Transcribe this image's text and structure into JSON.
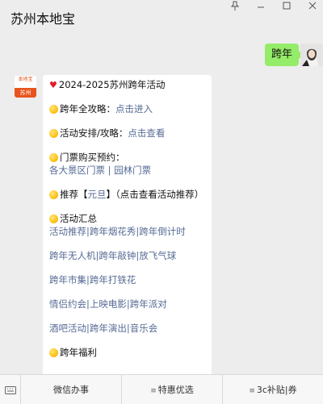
{
  "header": {
    "title": "苏州本地宝",
    "icons": [
      "pin-icon",
      "minimize-icon",
      "maximize-icon",
      "close-icon"
    ]
  },
  "outgoing": {
    "text": "跨年"
  },
  "account_avatar": {
    "top_text": "本地宝",
    "bottom_text": "苏州"
  },
  "message": {
    "heading_prefix": "♥",
    "heading": "2024-2025苏州跨年活动",
    "guide_label": "跨年全攻略：",
    "guide_link": "点击进入",
    "schedule_label": "活动安排/攻略：",
    "schedule_link": "点击查看",
    "tickets_label": "门票购买预约：",
    "tickets_link1": "各大景区门票",
    "tickets_sep": " | ",
    "tickets_link2": "园林门票",
    "recommend_label": "推荐【",
    "recommend_link": "元旦",
    "recommend_tail": "】（点击查看活动推荐）",
    "summary_label": "活动汇总",
    "summary_rows": [
      [
        "活动推荐",
        "跨年烟花秀",
        "跨年倒计时"
      ],
      [
        "跨年无人机",
        "跨年敲钟",
        "放飞气球"
      ],
      [
        "跨年市集",
        "跨年打铁花"
      ],
      [
        "情侣约会",
        "上映电影",
        "跨年派对"
      ],
      [
        "酒吧活动",
        "跨年演出",
        "音乐会"
      ]
    ],
    "welfare_label": "跨年福利"
  },
  "bottom_menu": {
    "items": [
      "微信办事",
      "特惠优选",
      "3c补贴|券"
    ]
  }
}
